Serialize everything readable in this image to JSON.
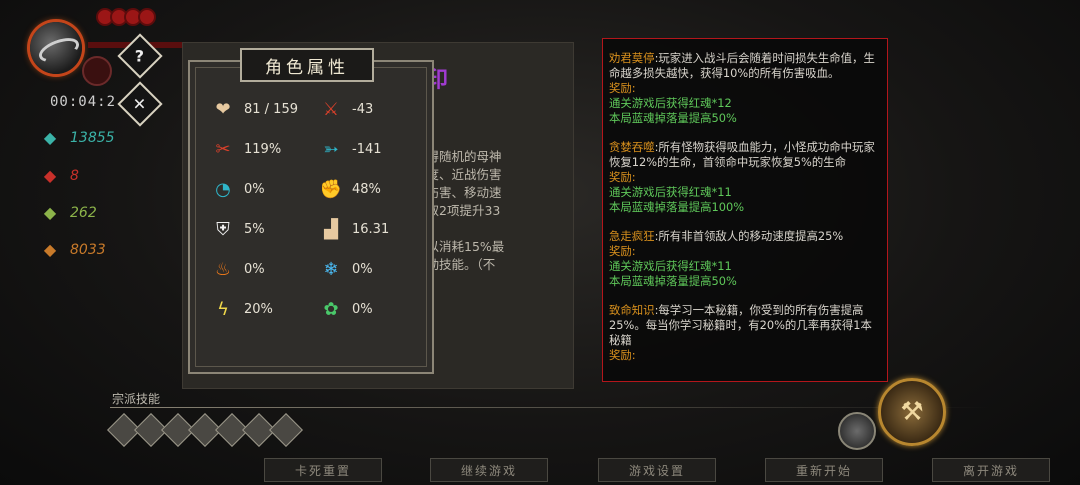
{
  "hud": {
    "timer": "00:04:2",
    "help_icon": "?",
    "close_icon": "✕",
    "lives_count": 4,
    "resources": [
      {
        "icon": "blue-soul-icon",
        "value": "13855",
        "color": "#3bb3a8"
      },
      {
        "icon": "red-soul-icon",
        "value": "8",
        "color": "#c8302a"
      },
      {
        "icon": "green-sigil-icon",
        "value": "262",
        "color": "#8cb34a"
      },
      {
        "icon": "orange-coin-icon",
        "value": "8033",
        "color": "#c87a2a"
      }
    ]
  },
  "background_panel": {
    "title": "印",
    "lines": [
      "获得随机的母神",
      "速度、近战伤害",
      "刺伤害、移动速",
      "抽取2项提升33",
      "",
      "可以消耗15%最",
      "主动技能。（不"
    ]
  },
  "attributes": {
    "title": "角色属性",
    "stats": [
      {
        "name": "health-icon",
        "glyph": "❤",
        "color": "#e7c9a0",
        "value": "81 / 159"
      },
      {
        "name": "attack-icon",
        "glyph": "⚔",
        "color": "#d8402a",
        "value": "-43"
      },
      {
        "name": "crit-claw-icon",
        "glyph": "✂",
        "color": "#d8402a",
        "value": "119%"
      },
      {
        "name": "dash-icon",
        "glyph": "➳",
        "color": "#2fb5c9",
        "value": "-141"
      },
      {
        "name": "cooldown-icon",
        "glyph": "◔",
        "color": "#2fb5c9",
        "value": "0%"
      },
      {
        "name": "fist-icon",
        "glyph": "✊",
        "color": "#e7c9a0",
        "value": "48%"
      },
      {
        "name": "shield-icon",
        "glyph": "⛨",
        "color": "#f0f0f0",
        "value": "5%"
      },
      {
        "name": "boot-icon",
        "glyph": "▟",
        "color": "#e7c9a0",
        "value": "16.31"
      },
      {
        "name": "fire-icon",
        "glyph": "♨",
        "color": "#f07a1a",
        "value": "0%"
      },
      {
        "name": "ice-icon",
        "glyph": "❄",
        "color": "#4ab8f0",
        "value": "0%"
      },
      {
        "name": "lightning-icon",
        "glyph": "ϟ",
        "color": "#f0d84a",
        "value": "20%"
      },
      {
        "name": "poison-icon",
        "glyph": "✿",
        "color": "#4ac86a",
        "value": "0%"
      }
    ]
  },
  "info": {
    "blocks": [
      {
        "name": "劝君莫停",
        "desc": ":玩家进入战斗后会随着时间损失生命值，生命越多损失越快，获得10%的所有伤害吸血。",
        "reward_label": "奖励:",
        "rewards": [
          "通关游戏后获得红魂*12",
          "本局蓝魂掉落量提高50%"
        ]
      },
      {
        "name": "贪婪吞噬",
        "desc": ":所有怪物获得吸血能力，小怪成功命中玩家恢复12%的生命，首领命中玩家恢复5%的生命",
        "reward_label": "奖励:",
        "rewards": [
          "通关游戏后获得红魂*11",
          "本局蓝魂掉落量提高100%"
        ]
      },
      {
        "name": "急走疯狂",
        "desc": ":所有非首领敌人的移动速度提高25%",
        "reward_label": "奖励:",
        "rewards": [
          "通关游戏后获得红魂*11",
          "本局蓝魂掉落量提高50%"
        ]
      },
      {
        "name": "致命知识",
        "desc": ":每学习一本秘籍，你受到的所有伤害提高25%。每当你学习秘籍时，有20%的几率再获得1本秘籍",
        "reward_label": "奖励:",
        "rewards": []
      }
    ]
  },
  "skills": {
    "label": "宗派技能",
    "icon_count": 7
  },
  "menu": [
    "卡死重置",
    "继续游戏",
    "游戏设置",
    "重新开始",
    "离开游戏"
  ]
}
